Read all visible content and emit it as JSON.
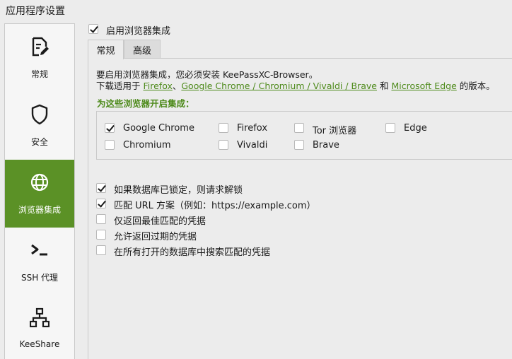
{
  "window": {
    "title": "应用程序设置"
  },
  "sidebar": {
    "items": [
      {
        "label": "常规",
        "icon": "edit-document-icon",
        "active": false
      },
      {
        "label": "安全",
        "icon": "shield-icon",
        "active": false
      },
      {
        "label": "浏览器集成",
        "icon": "globe-icon",
        "active": true
      },
      {
        "label": "SSH 代理",
        "icon": "terminal-icon",
        "active": false
      },
      {
        "label": "KeeShare",
        "icon": "network-icon",
        "active": false
      }
    ]
  },
  "enable_integration": {
    "label": "启用浏览器集成",
    "checked": true
  },
  "tabs": [
    {
      "label": "常规",
      "active": true
    },
    {
      "label": "高级",
      "active": false
    }
  ],
  "description": {
    "line1": "要启用浏览器集成，您必须安装 KeePassXC-Browser。",
    "line2_prefix": "下载适用于 ",
    "link_firefox": "Firefox",
    "sep": "、",
    "link_chrome": "Google Chrome / Chromium / Vivaldi / Brave",
    "and": " 和 ",
    "link_edge": "Microsoft Edge",
    "line2_suffix": " 的版本。"
  },
  "browsers_section": {
    "title": "为这些浏览器开启集成：",
    "browsers": [
      {
        "label": "Google Chrome",
        "checked": true
      },
      {
        "label": "Firefox",
        "checked": false
      },
      {
        "label": "Tor 浏览器",
        "checked": false
      },
      {
        "label": "Edge",
        "checked": false
      },
      {
        "label": "Chromium",
        "checked": false
      },
      {
        "label": "Vivaldi",
        "checked": false
      },
      {
        "label": "Brave",
        "checked": false
      }
    ]
  },
  "options": [
    {
      "label": "如果数据库已锁定，则请求解锁",
      "checked": true
    },
    {
      "label": "匹配 URL 方案（例如：https://example.com）",
      "checked": true
    },
    {
      "label": "仅返回最佳匹配的凭据",
      "checked": false
    },
    {
      "label": "允许返回过期的凭据",
      "checked": false
    },
    {
      "label": "在所有打开的数据库中搜索匹配的凭据",
      "checked": false
    }
  ],
  "colors": {
    "accent": "#5b9126",
    "link": "#4d8a1a",
    "background": "#ececec"
  }
}
